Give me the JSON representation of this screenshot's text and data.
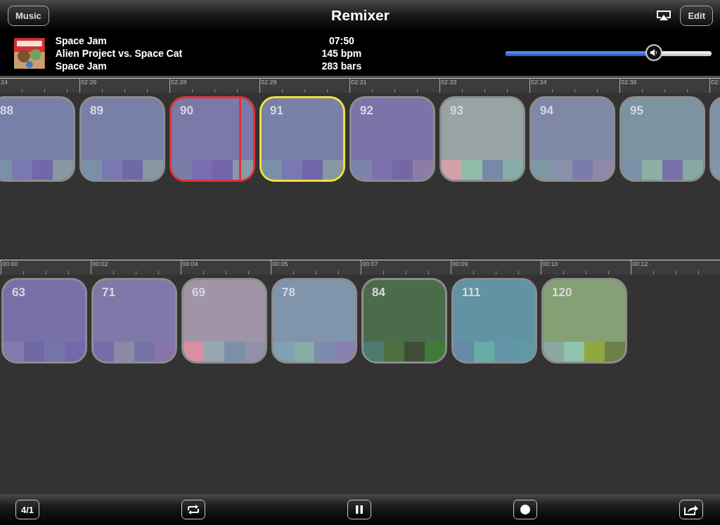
{
  "window": {
    "title": "Remixer",
    "left_button": "Music",
    "right_button": "Edit"
  },
  "now_playing": {
    "title": "Space Jam",
    "artist": "Alien Project vs. Space Cat",
    "album": "Space Jam",
    "duration": "07:50",
    "tempo": "145 bpm",
    "length": "283 bars",
    "volume": {
      "level": 0.72
    }
  },
  "timeline": {
    "ruler": [
      "24",
      "02:26",
      "02:28",
      "02:29",
      "02:31",
      "02:33",
      "02:34",
      "02:36",
      "02:"
    ],
    "tiles": [
      {
        "number": "88",
        "color": "#7880a8",
        "swatches": [
          {
            "color": "#7890a8"
          },
          {
            "color": "#7a78b0"
          },
          {
            "color": "#7068a8"
          },
          {
            "color": "#8898a0"
          }
        ],
        "playing": false,
        "queued": false
      },
      {
        "number": "89",
        "color": "#7880a8",
        "swatches": [
          {
            "color": "#7890a8"
          },
          {
            "color": "#7a78b0"
          },
          {
            "color": "#7068a8"
          },
          {
            "color": "#8898a0"
          }
        ],
        "playing": false,
        "queued": false
      },
      {
        "number": "90",
        "color": "#7c78a8",
        "swatches": [
          {
            "color": "#7c7ca8"
          },
          {
            "color": "#7a6cb0"
          },
          {
            "color": "#7464ac"
          },
          {
            "color": "#8a98a8"
          }
        ],
        "playing": true,
        "queued": false,
        "level": 0.83
      },
      {
        "number": "91",
        "color": "#7880a8",
        "swatches": [
          {
            "color": "#7890a8"
          },
          {
            "color": "#7a78b0"
          },
          {
            "color": "#7068a8"
          },
          {
            "color": "#8898a0"
          }
        ],
        "playing": false,
        "queued": true
      },
      {
        "number": "92",
        "color": "#7c74a8",
        "swatches": [
          {
            "color": "#7c84ac"
          },
          {
            "color": "#7c70ac"
          },
          {
            "color": "#7468a4"
          },
          {
            "color": "#8c7ca8"
          }
        ],
        "playing": false,
        "queued": false
      },
      {
        "number": "93",
        "color": "#98a4a4",
        "swatches": [
          {
            "color": "#d4a0a8"
          },
          {
            "color": "#90bca8"
          },
          {
            "color": "#7888a8"
          },
          {
            "color": "#88aca8"
          }
        ],
        "playing": false,
        "queued": false
      },
      {
        "number": "94",
        "color": "#8088a8",
        "swatches": [
          {
            "color": "#8098a4"
          },
          {
            "color": "#8890ac"
          },
          {
            "color": "#7c7cac"
          },
          {
            "color": "#9088a8"
          }
        ],
        "playing": false,
        "queued": false
      },
      {
        "number": "95",
        "color": "#7c94a0",
        "swatches": [
          {
            "color": "#7890a8"
          },
          {
            "color": "#8cb0a8"
          },
          {
            "color": "#7870a8"
          },
          {
            "color": "#88a8a4"
          }
        ],
        "playing": false,
        "queued": false
      },
      {
        "color": "#8090a8",
        "swatches": [
          {
            "color": "#8494ac"
          }
        ],
        "playing": false,
        "queued": false
      }
    ]
  },
  "arrangement": {
    "ruler": [
      "00:00",
      "00:02",
      "00:04",
      "00:05",
      "00:07",
      "00:09",
      "00:10",
      "00:12"
    ],
    "tiles": [
      {
        "number": "63",
        "color": "#7870a8",
        "swatches": [
          {
            "color": "#8478ac"
          },
          {
            "color": "#7068a4"
          },
          {
            "color": "#7474a8"
          },
          {
            "color": "#7468ac"
          }
        ],
        "playing": false,
        "queued": false
      },
      {
        "number": "71",
        "color": "#8078a8",
        "swatches": [
          {
            "color": "#7a6cac"
          },
          {
            "color": "#8c88a8"
          },
          {
            "color": "#7474a4"
          },
          {
            "color": "#8874a8"
          }
        ],
        "playing": false,
        "queued": false
      },
      {
        "number": "69",
        "color": "#a094a8",
        "swatches": [
          {
            "color": "#d890a0"
          },
          {
            "color": "#98a8b0"
          },
          {
            "color": "#7c90a8"
          },
          {
            "color": "#9090a8"
          }
        ],
        "playing": false,
        "queued": false
      },
      {
        "number": "78",
        "color": "#8094ac",
        "swatches": [
          {
            "color": "#80a0b4"
          },
          {
            "color": "#88aca8"
          },
          {
            "color": "#7c8cac"
          },
          {
            "color": "#8880b0"
          }
        ],
        "playing": false,
        "queued": false
      },
      {
        "number": "84",
        "color": "#4a6c4a",
        "swatches": [
          {
            "color": "#4c7c70"
          },
          {
            "color": "#4c7040"
          },
          {
            "color": "#404c38"
          },
          {
            "color": "#407c38"
          }
        ],
        "playing": false,
        "queued": false
      },
      {
        "number": "111",
        "color": "#6094a4",
        "swatches": [
          {
            "color": "#6888a8"
          },
          {
            "color": "#68aca8"
          },
          {
            "color": "#6494a8"
          },
          {
            "color": "#6098a4"
          }
        ],
        "playing": false,
        "queued": false
      },
      {
        "number": "120",
        "color": "#84a074",
        "swatches": [
          {
            "color": "#8ca8a0"
          },
          {
            "color": "#90c4ac"
          },
          {
            "color": "#90a840"
          },
          {
            "color": "#6c8048"
          }
        ],
        "playing": false,
        "queued": false
      }
    ]
  },
  "toolbar": {
    "meter": "4/1",
    "playing": true
  }
}
